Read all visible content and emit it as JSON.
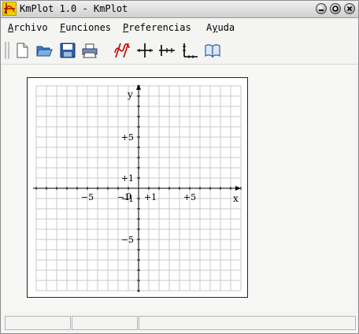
{
  "window": {
    "title": "KmPlot 1.0 - KmPlot"
  },
  "menubar": {
    "items": [
      {
        "accel": "A",
        "rest": "rchivo"
      },
      {
        "accel": "F",
        "rest": "unciones"
      },
      {
        "accel": "P",
        "rest": "referencias"
      },
      {
        "pre": "A",
        "accel": "y",
        "rest": "uda"
      }
    ]
  },
  "toolbar": {
    "icons": [
      "new-file-icon",
      "open-folder-icon",
      "save-floppy-icon",
      "print-icon",
      "new-function-icon",
      "axes-cross-icon",
      "horizontal-line-icon",
      "vertical-axes-icon",
      "open-book-icon"
    ]
  },
  "plot": {
    "x_label": "x",
    "y_label": "y",
    "x_tick_labels": [
      "−5",
      "−1",
      "+1",
      "+5"
    ],
    "y_tick_labels": [
      "+5",
      "+1",
      "−1",
      "−5"
    ],
    "origin_label": "0",
    "grid": true
  },
  "statusbar": {
    "cells": [
      "",
      "",
      ""
    ]
  }
}
